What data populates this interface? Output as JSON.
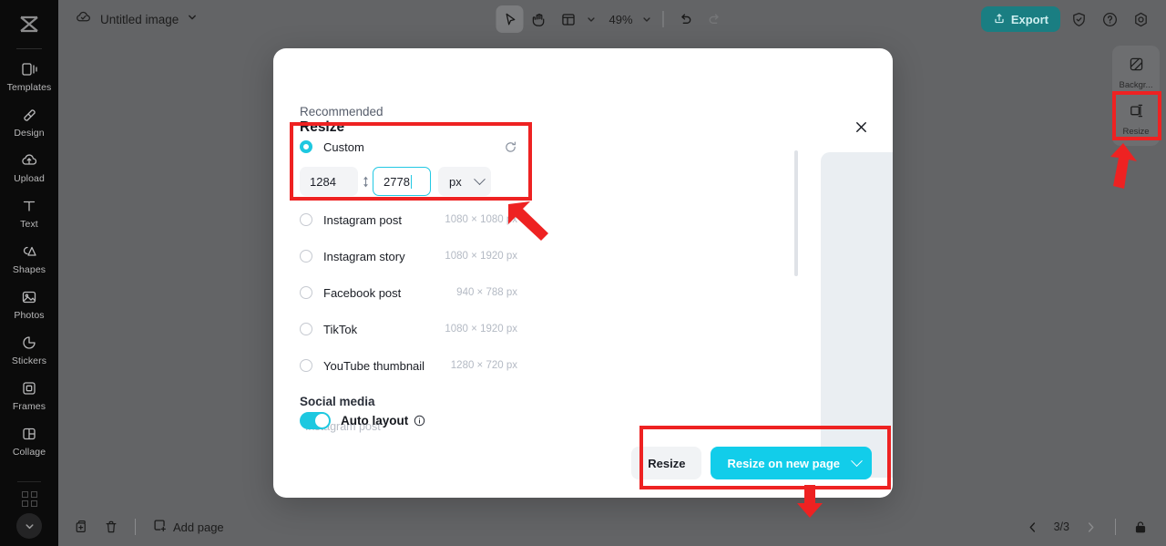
{
  "app": {
    "logo": "capcut-logo",
    "doc_title": "Untitled image",
    "cloud_icon": "cloud-check-icon",
    "title_caret": "chevron-down-icon"
  },
  "sidebar": {
    "items": [
      {
        "label": "Templates",
        "icon": "templates-icon"
      },
      {
        "label": "Design",
        "icon": "design-icon"
      },
      {
        "label": "Upload",
        "icon": "upload-cloud-icon"
      },
      {
        "label": "Text",
        "icon": "text-icon"
      },
      {
        "label": "Shapes",
        "icon": "shapes-icon"
      },
      {
        "label": "Photos",
        "icon": "photos-icon"
      },
      {
        "label": "Stickers",
        "icon": "stickers-icon"
      },
      {
        "label": "Frames",
        "icon": "frames-icon"
      },
      {
        "label": "Collage",
        "icon": "collage-icon"
      }
    ],
    "more_icon": "apps-grid-icon",
    "expand_icon": "chevron-down-icon"
  },
  "toolbar": {
    "select_tool": "cursor-select-icon",
    "hand_tool": "hand-pan-icon",
    "layout_tool": "layout-grid-icon",
    "layout_caret": "chevron-down-icon",
    "zoom_level": "49%",
    "zoom_caret": "chevron-down-icon",
    "undo_icon": "undo-icon",
    "redo_icon": "redo-icon",
    "export_label": "Export",
    "export_icon": "export-upload-icon",
    "export_color": "#1a7e82",
    "shield_icon": "shield-check-icon",
    "help_icon": "help-circle-icon",
    "settings_icon": "settings-gear-icon"
  },
  "right_panel": {
    "items": [
      {
        "label": "Backgr...",
        "icon": "background-icon"
      },
      {
        "label": "Resize",
        "icon": "resize-icon"
      }
    ]
  },
  "bottom_bar": {
    "duplicate_icon": "duplicate-page-icon",
    "delete_icon": "trash-icon",
    "add_page_label": "Add page",
    "add_page_icon": "add-page-icon",
    "prev_icon": "chevron-left-icon",
    "next_icon": "chevron-right-icon",
    "page_indicator": "3/3",
    "unlock_icon": "lock-open-icon"
  },
  "dialog": {
    "title": "Resize",
    "close_icon": "close-icon",
    "section_recommended": "Recommended",
    "custom": {
      "label": "Custom",
      "selected": true,
      "reset_icon": "reset-rotate-icon",
      "width_value": "1284",
      "height_value": "2778",
      "link_icon": "link-dimensions-icon",
      "unit_value": "px",
      "unit_caret": "chevron-down-icon"
    },
    "presets": [
      {
        "label": "Instagram post",
        "dimensions": "1080 × 1080 px",
        "selected": false
      },
      {
        "label": "Instagram story",
        "dimensions": "1080 × 1920 px",
        "selected": false
      },
      {
        "label": "Facebook post",
        "dimensions": "940 × 788 px",
        "selected": false
      },
      {
        "label": "TikTok",
        "dimensions": "1080 × 1920 px",
        "selected": false
      },
      {
        "label": "YouTube thumbnail",
        "dimensions": "1280 × 720 px",
        "selected": false
      }
    ],
    "section_social": "Social media",
    "social_first_item": "Instagram post",
    "auto_layout": {
      "label": "Auto layout",
      "info_icon": "info-circle-icon",
      "enabled": true,
      "color": "#1ec8e0"
    },
    "footer": {
      "resize_label": "Resize",
      "resize_new_page_label": "Resize on new page",
      "primary_color": "#12cdea",
      "caret_icon": "chevron-down-icon"
    }
  },
  "annotations": {
    "highlight_color": "#ee2222",
    "boxes": [
      "custom-size-field-highlight",
      "resize-buttons-highlight",
      "right-panel-resize-highlight"
    ],
    "arrows": [
      "arrow-to-custom-field",
      "arrow-to-resize-buttons",
      "arrow-to-panel-resize"
    ]
  }
}
